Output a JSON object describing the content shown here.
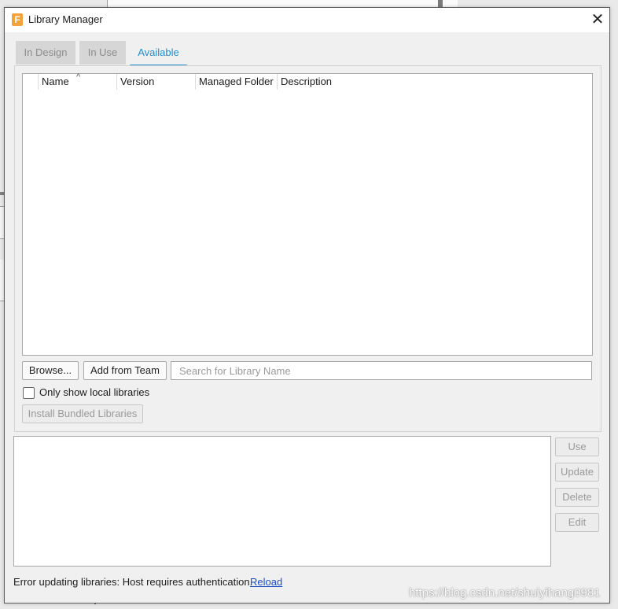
{
  "window": {
    "title": "Library Manager",
    "app_icon_letter": "F",
    "close_glyph": "✕"
  },
  "tabs": [
    {
      "label": "In Design",
      "state": "inactive"
    },
    {
      "label": "In Use",
      "state": "inactive"
    },
    {
      "label": "Available",
      "state": "selected"
    }
  ],
  "table": {
    "columns": [
      "Name",
      "Version",
      "Managed Folder",
      "Description"
    ],
    "sort_glyph": "^",
    "rows": []
  },
  "actions": {
    "browse_label": "Browse...",
    "add_from_team_label": "Add from Team",
    "search_placeholder": "Search for Library Name",
    "search_value": "",
    "local_only_label": "Only show local libraries",
    "local_only_checked": false,
    "install_bundled_label": "Install Bundled Libraries"
  },
  "side_buttons": [
    "Use",
    "Update",
    "Delete",
    "Edit"
  ],
  "status": {
    "message": "Error updating libraries: Host requires authentication.",
    "reload_label": "Reload"
  },
  "watermark": "https://blog.csdn.net/shuiyihang0981",
  "colors": {
    "accent": "#2b95d4",
    "link": "#1a4cc9",
    "app_icon": "#f4a23a"
  },
  "icons": {
    "app": "fusion-app-icon",
    "close": "close-icon",
    "sort": "sort-ascending-icon",
    "checkbox": "checkbox-unchecked-icon"
  }
}
